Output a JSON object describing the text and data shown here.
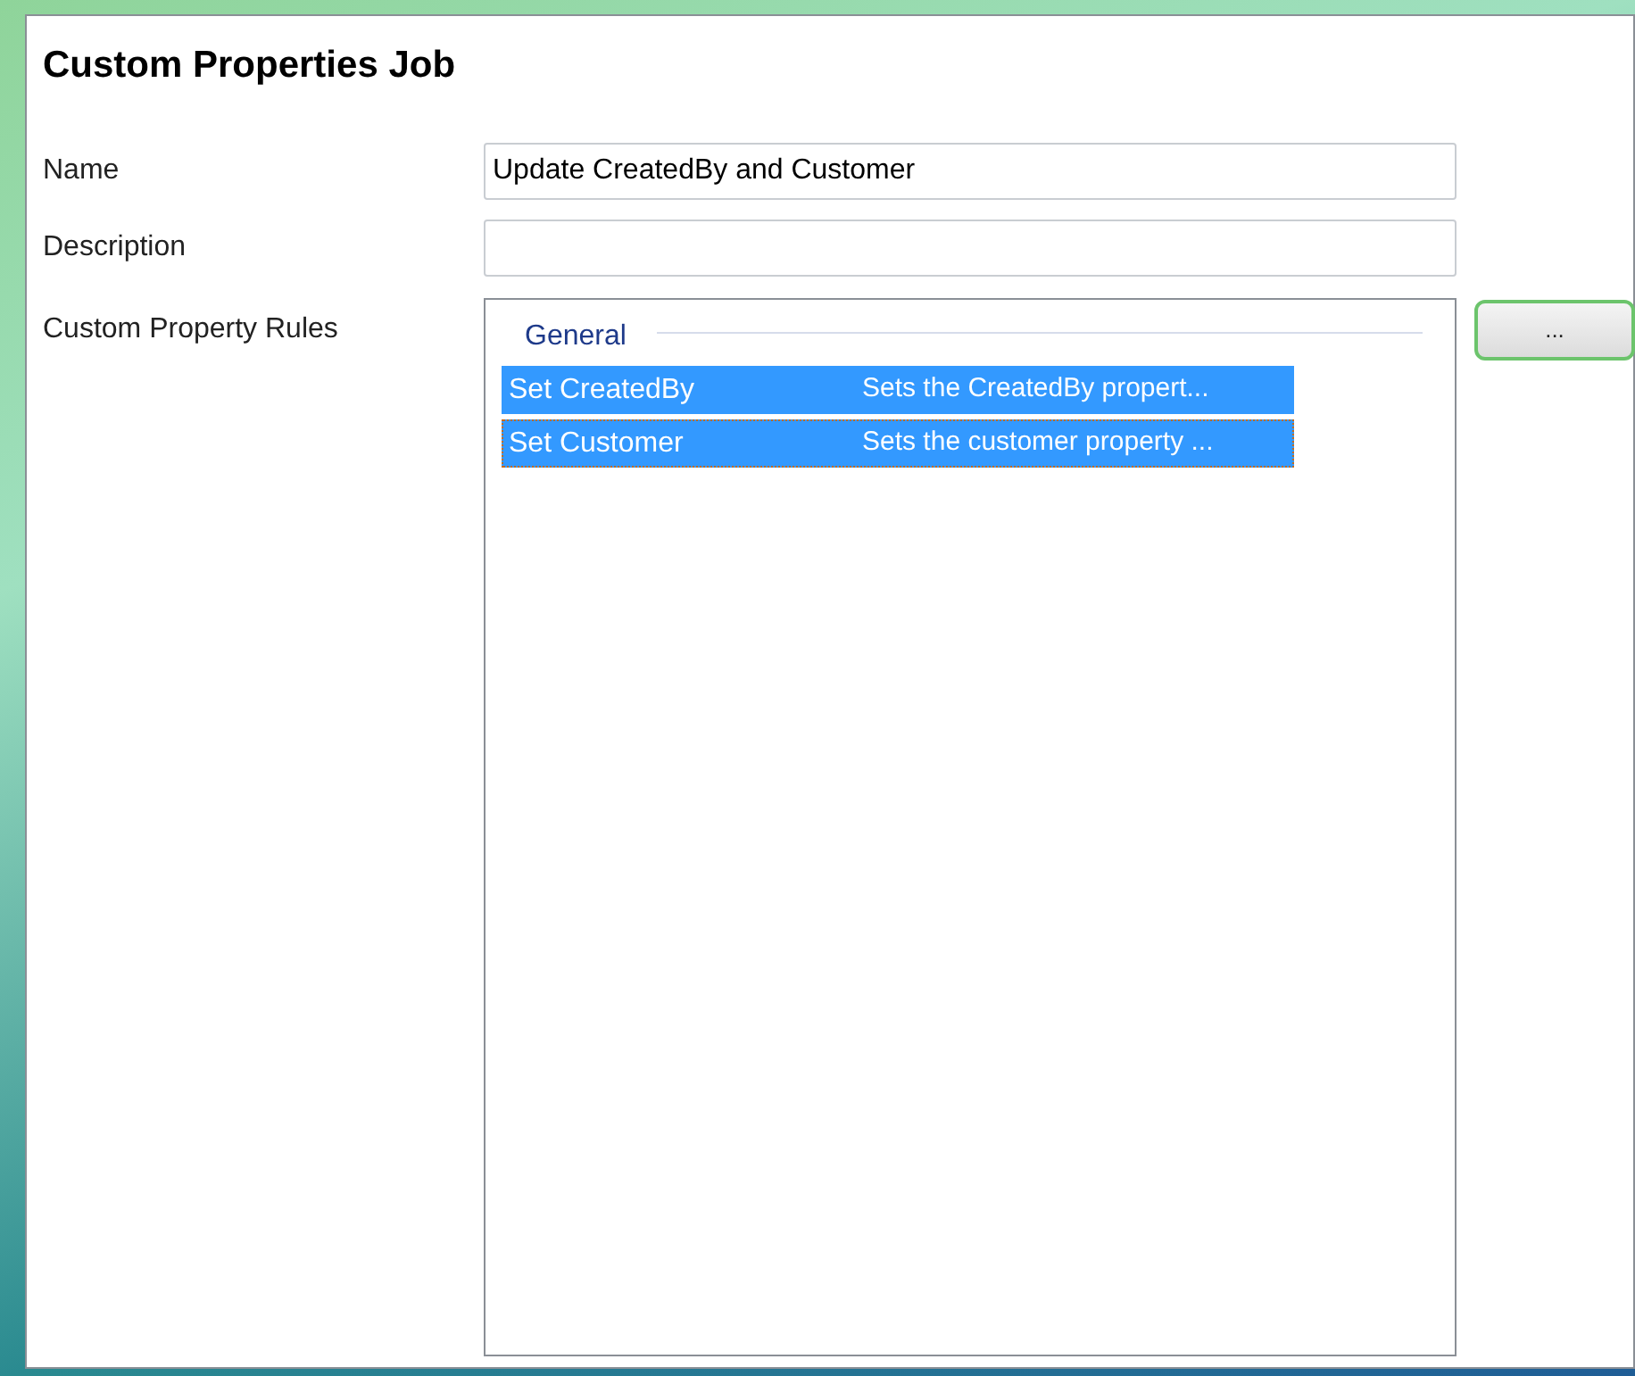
{
  "title": "Custom Properties Job",
  "fields": [
    {
      "label": "Name",
      "value": "Update CreatedBy and Customer"
    },
    {
      "label": "Description"
    }
  ],
  "rules": {
    "label": "Custom Property Rules",
    "group": "General",
    "rows": [
      {
        "name": "Set CreatedBy",
        "description": "Sets the CreatedBy propert...",
        "selected": true,
        "focused": false
      },
      {
        "name": "Set Customer",
        "description": "Sets the customer property ...",
        "selected": true,
        "focused": true
      }
    ],
    "button": "..."
  }
}
